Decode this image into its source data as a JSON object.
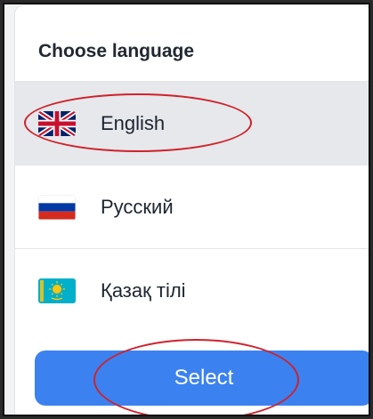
{
  "dialog": {
    "title": "Choose language",
    "options": [
      {
        "label": "English",
        "flag": "uk-flag-icon",
        "selected": true
      },
      {
        "label": "Русский",
        "flag": "russia-flag-icon",
        "selected": false
      },
      {
        "label": "Қазақ тілі",
        "flag": "kazakhstan-flag-icon",
        "selected": false
      }
    ],
    "select_label": "Select"
  },
  "colors": {
    "accent": "#3b82f0",
    "selected_row": "#e6e8ec",
    "annotation": "#d0212a"
  }
}
